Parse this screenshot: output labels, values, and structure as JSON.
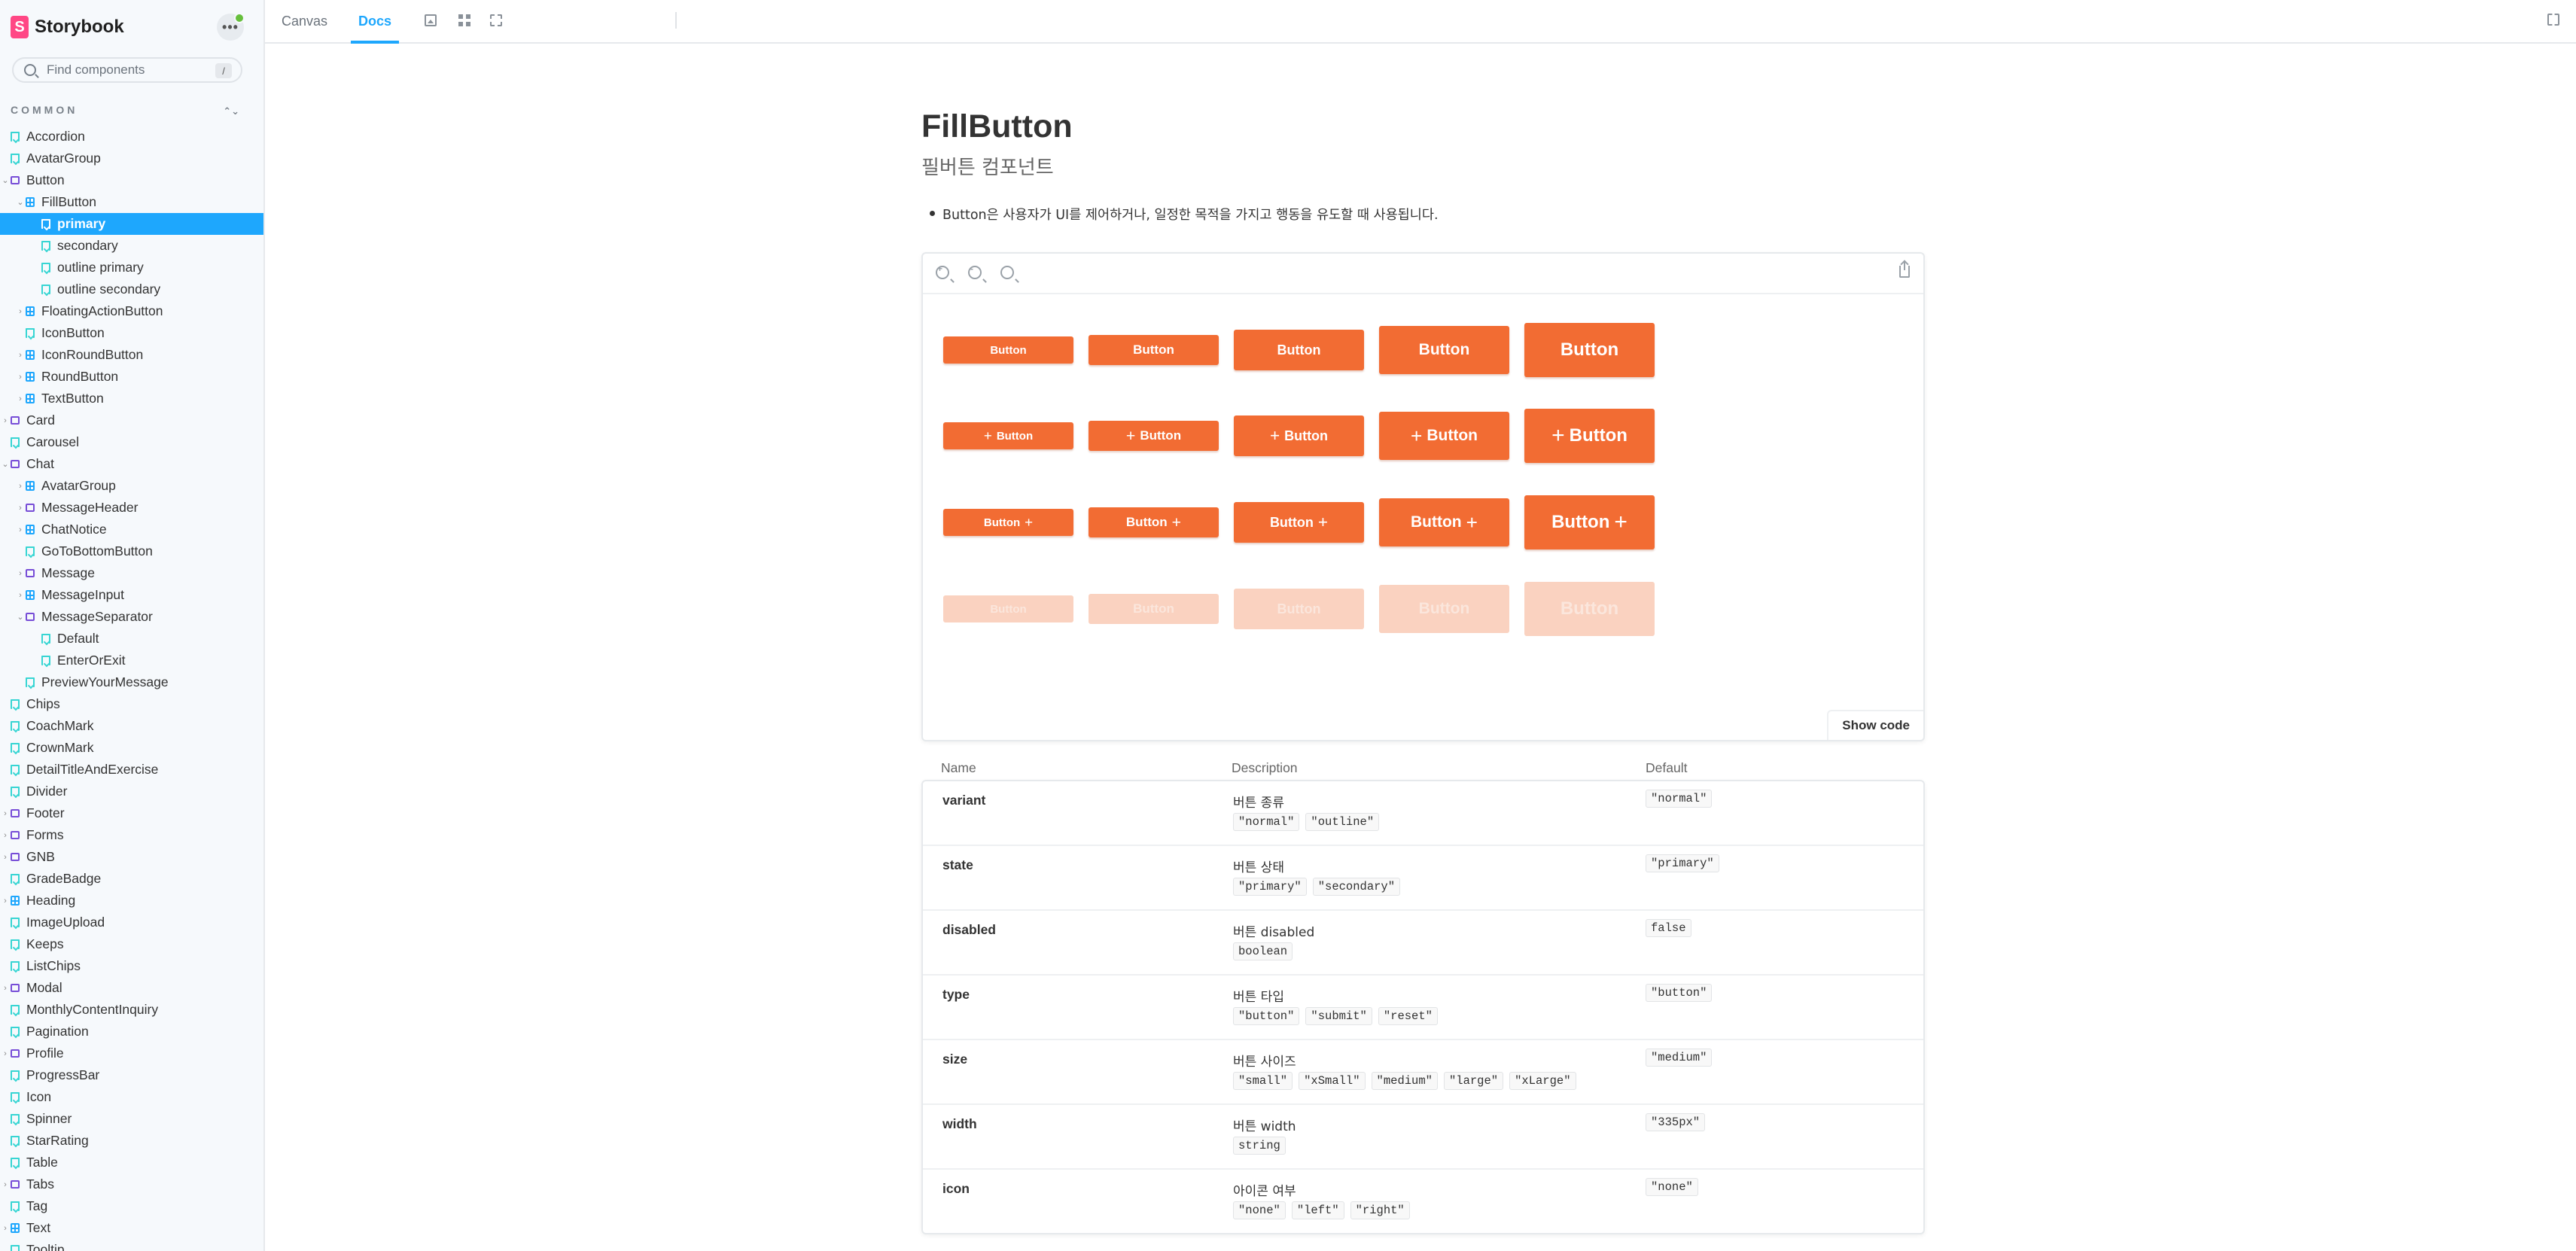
{
  "brand": {
    "name": "Storybook",
    "logo_letter": "S"
  },
  "search": {
    "placeholder": "Find components",
    "shortcut": "/"
  },
  "sidebar": {
    "group_label": "COMMON",
    "items": [
      {
        "label": "Accordion",
        "type": "story",
        "depth": 0
      },
      {
        "label": "AvatarGroup",
        "type": "story",
        "depth": 0
      },
      {
        "label": "Button",
        "type": "folder",
        "depth": 0,
        "chevron": "down"
      },
      {
        "label": "FillButton",
        "type": "component",
        "depth": 1,
        "chevron": "down"
      },
      {
        "label": "primary",
        "type": "story",
        "depth": 2,
        "selected": true
      },
      {
        "label": "secondary",
        "type": "story",
        "depth": 2
      },
      {
        "label": "outline primary",
        "type": "story",
        "depth": 2
      },
      {
        "label": "outline secondary",
        "type": "story",
        "depth": 2
      },
      {
        "label": "FloatingActionButton",
        "type": "component",
        "depth": 1,
        "chevron": "right"
      },
      {
        "label": "IconButton",
        "type": "story",
        "depth": 1
      },
      {
        "label": "IconRoundButton",
        "type": "component",
        "depth": 1,
        "chevron": "right"
      },
      {
        "label": "RoundButton",
        "type": "component",
        "depth": 1,
        "chevron": "right"
      },
      {
        "label": "TextButton",
        "type": "component",
        "depth": 1,
        "chevron": "right"
      },
      {
        "label": "Card",
        "type": "folder",
        "depth": 0,
        "chevron": "right"
      },
      {
        "label": "Carousel",
        "type": "story",
        "depth": 0
      },
      {
        "label": "Chat",
        "type": "folder",
        "depth": 0,
        "chevron": "down"
      },
      {
        "label": "AvatarGroup",
        "type": "component",
        "depth": 1,
        "chevron": "right"
      },
      {
        "label": "MessageHeader",
        "type": "folder",
        "depth": 1,
        "chevron": "right"
      },
      {
        "label": "ChatNotice",
        "type": "component",
        "depth": 1,
        "chevron": "right"
      },
      {
        "label": "GoToBottomButton",
        "type": "story",
        "depth": 1
      },
      {
        "label": "Message",
        "type": "folder",
        "depth": 1,
        "chevron": "right"
      },
      {
        "label": "MessageInput",
        "type": "component",
        "depth": 1,
        "chevron": "right"
      },
      {
        "label": "MessageSeparator",
        "type": "folder",
        "depth": 1,
        "chevron": "down"
      },
      {
        "label": "Default",
        "type": "story",
        "depth": 2
      },
      {
        "label": "EnterOrExit",
        "type": "story",
        "depth": 2
      },
      {
        "label": "PreviewYourMessage",
        "type": "story",
        "depth": 1
      },
      {
        "label": "Chips",
        "type": "story",
        "depth": 0
      },
      {
        "label": "CoachMark",
        "type": "story",
        "depth": 0
      },
      {
        "label": "CrownMark",
        "type": "story",
        "depth": 0
      },
      {
        "label": "DetailTitleAndExercise",
        "type": "story",
        "depth": 0
      },
      {
        "label": "Divider",
        "type": "story",
        "depth": 0
      },
      {
        "label": "Footer",
        "type": "folder",
        "depth": 0,
        "chevron": "right"
      },
      {
        "label": "Forms",
        "type": "folder",
        "depth": 0,
        "chevron": "right"
      },
      {
        "label": "GNB",
        "type": "folder",
        "depth": 0,
        "chevron": "right"
      },
      {
        "label": "GradeBadge",
        "type": "story",
        "depth": 0
      },
      {
        "label": "Heading",
        "type": "component",
        "depth": 0,
        "chevron": "right"
      },
      {
        "label": "ImageUpload",
        "type": "story",
        "depth": 0
      },
      {
        "label": "Keeps",
        "type": "story",
        "depth": 0
      },
      {
        "label": "ListChips",
        "type": "story",
        "depth": 0
      },
      {
        "label": "Modal",
        "type": "folder",
        "depth": 0,
        "chevron": "right"
      },
      {
        "label": "MonthlyContentInquiry",
        "type": "story",
        "depth": 0
      },
      {
        "label": "Pagination",
        "type": "story",
        "depth": 0
      },
      {
        "label": "Profile",
        "type": "folder",
        "depth": 0,
        "chevron": "right"
      },
      {
        "label": "ProgressBar",
        "type": "story",
        "depth": 0
      },
      {
        "label": "Icon",
        "type": "story",
        "depth": 0
      },
      {
        "label": "Spinner",
        "type": "story",
        "depth": 0
      },
      {
        "label": "StarRating",
        "type": "story",
        "depth": 0
      },
      {
        "label": "Table",
        "type": "story",
        "depth": 0
      },
      {
        "label": "Tabs",
        "type": "folder",
        "depth": 0,
        "chevron": "right"
      },
      {
        "label": "Tag",
        "type": "story",
        "depth": 0
      },
      {
        "label": "Text",
        "type": "component",
        "depth": 0,
        "chevron": "right"
      },
      {
        "label": "Tooltip",
        "type": "story",
        "depth": 0
      }
    ]
  },
  "toolbar": {
    "tabs": [
      {
        "label": "Canvas",
        "active": false
      },
      {
        "label": "Docs",
        "active": true
      }
    ],
    "icons": [
      "image-icon",
      "grid-icon",
      "outline-icon",
      "fullscreen-icon"
    ]
  },
  "docs": {
    "title": "FillButton",
    "subtitle": "필버튼 컴포넌트",
    "bullet": "Button은 사용자가 UI를 제어하거나, 일정한 목적을 가지고 행동을 유도할 때 사용됩니다.",
    "preview": {
      "button_label": "Button",
      "plus": "+",
      "rows": [
        "plain",
        "icon-left",
        "icon-right",
        "disabled"
      ],
      "show_code": "Show code"
    },
    "args_table": {
      "headers": {
        "name": "Name",
        "description": "Description",
        "default": "Default"
      },
      "rows": [
        {
          "name": "variant",
          "description": "버튼 종류",
          "options": [
            "\"normal\"",
            "\"outline\""
          ],
          "default": "\"normal\""
        },
        {
          "name": "state",
          "description": "버튼 상태",
          "options": [
            "\"primary\"",
            "\"secondary\""
          ],
          "default": "\"primary\""
        },
        {
          "name": "disabled",
          "description": "버튼 disabled",
          "options": [
            "boolean"
          ],
          "default": "false"
        },
        {
          "name": "type",
          "description": "버튼 타입",
          "options": [
            "\"button\"",
            "\"submit\"",
            "\"reset\""
          ],
          "default": "\"button\""
        },
        {
          "name": "size",
          "description": "버튼 사이즈",
          "options": [
            "\"small\"",
            "\"xSmall\"",
            "\"medium\"",
            "\"large\"",
            "\"xLarge\""
          ],
          "default": "\"medium\""
        },
        {
          "name": "width",
          "description": "버튼 width",
          "options": [
            "string"
          ],
          "default": "\"335px\""
        },
        {
          "name": "icon",
          "description": "아이콘 여부",
          "options": [
            "\"none\"",
            "\"left\"",
            "\"right\""
          ],
          "default": "\"none\""
        }
      ]
    }
  },
  "colors": {
    "accent": "#1ea7fd",
    "button_fill": "#f26c33",
    "button_disabled": "#fad2c0",
    "brand": "#ff4785"
  }
}
